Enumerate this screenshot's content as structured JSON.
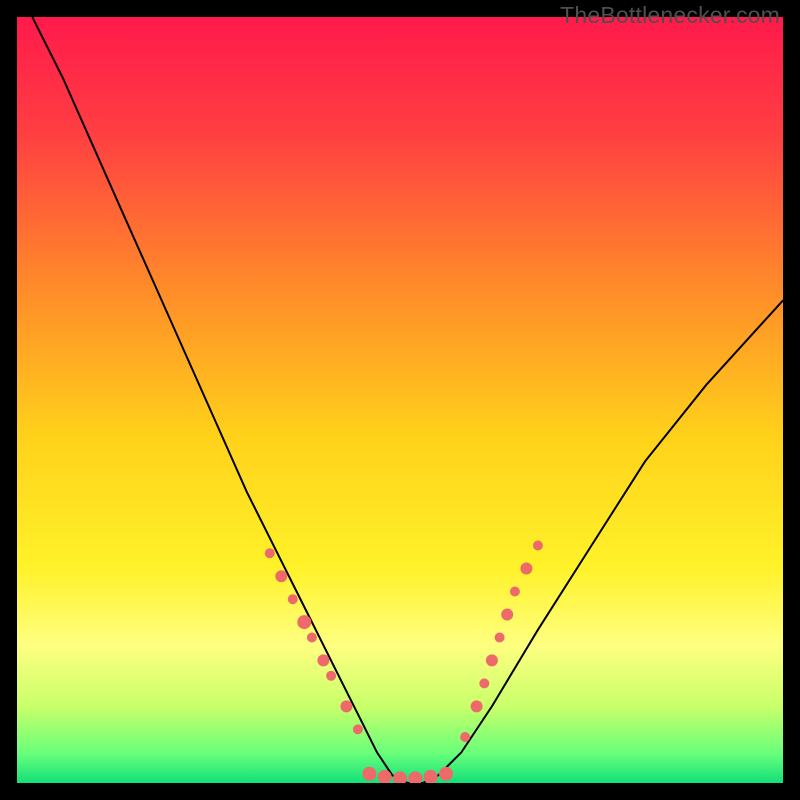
{
  "watermark": "TheBottlenecker.com",
  "chart_data": {
    "type": "line",
    "title": "",
    "xlabel": "",
    "ylabel": "",
    "xlim": [
      0,
      100
    ],
    "ylim": [
      0,
      100
    ],
    "grid": false,
    "legend": false,
    "background_gradient": {
      "stops": [
        {
          "offset": 0.0,
          "color": "#ff1a4b"
        },
        {
          "offset": 0.15,
          "color": "#ff3e42"
        },
        {
          "offset": 0.35,
          "color": "#ff8a2a"
        },
        {
          "offset": 0.55,
          "color": "#ffd21a"
        },
        {
          "offset": 0.72,
          "color": "#fff22a"
        },
        {
          "offset": 0.82,
          "color": "#ffff80"
        },
        {
          "offset": 0.9,
          "color": "#c8ff6a"
        },
        {
          "offset": 0.96,
          "color": "#6bff7a"
        },
        {
          "offset": 1.0,
          "color": "#12e07a"
        }
      ]
    },
    "series": [
      {
        "name": "bottleneck-curve",
        "color": "#000000",
        "x": [
          2,
          6,
          10,
          14,
          18,
          22,
          26,
          30,
          34,
          38,
          42,
          45,
          47,
          49,
          51,
          53,
          55,
          58,
          62,
          68,
          75,
          82,
          90,
          100
        ],
        "y": [
          100,
          92,
          83,
          74,
          65,
          56,
          47,
          38,
          30,
          22,
          14,
          8,
          4,
          1,
          0,
          0,
          1,
          4,
          10,
          20,
          31,
          42,
          52,
          63
        ]
      }
    ],
    "markers": {
      "color": "#ee6a6a",
      "radius_small": 5,
      "radius_large": 7,
      "points": [
        {
          "x": 33.0,
          "y": 30.0,
          "r": 5
        },
        {
          "x": 34.5,
          "y": 27.0,
          "r": 6
        },
        {
          "x": 36.0,
          "y": 24.0,
          "r": 5
        },
        {
          "x": 37.5,
          "y": 21.0,
          "r": 7
        },
        {
          "x": 38.5,
          "y": 19.0,
          "r": 5
        },
        {
          "x": 40.0,
          "y": 16.0,
          "r": 6
        },
        {
          "x": 41.0,
          "y": 14.0,
          "r": 5
        },
        {
          "x": 43.0,
          "y": 10.0,
          "r": 6
        },
        {
          "x": 44.5,
          "y": 7.0,
          "r": 5
        },
        {
          "x": 46.0,
          "y": 1.2,
          "r": 7
        },
        {
          "x": 48.0,
          "y": 0.8,
          "r": 7
        },
        {
          "x": 50.0,
          "y": 0.6,
          "r": 7
        },
        {
          "x": 52.0,
          "y": 0.6,
          "r": 7
        },
        {
          "x": 54.0,
          "y": 0.8,
          "r": 7
        },
        {
          "x": 56.0,
          "y": 1.2,
          "r": 7
        },
        {
          "x": 58.5,
          "y": 6.0,
          "r": 5
        },
        {
          "x": 60.0,
          "y": 10.0,
          "r": 6
        },
        {
          "x": 61.0,
          "y": 13.0,
          "r": 5
        },
        {
          "x": 62.0,
          "y": 16.0,
          "r": 6
        },
        {
          "x": 63.0,
          "y": 19.0,
          "r": 5
        },
        {
          "x": 64.0,
          "y": 22.0,
          "r": 6
        },
        {
          "x": 65.0,
          "y": 25.0,
          "r": 5
        },
        {
          "x": 66.5,
          "y": 28.0,
          "r": 6
        },
        {
          "x": 68.0,
          "y": 31.0,
          "r": 5
        }
      ]
    }
  }
}
